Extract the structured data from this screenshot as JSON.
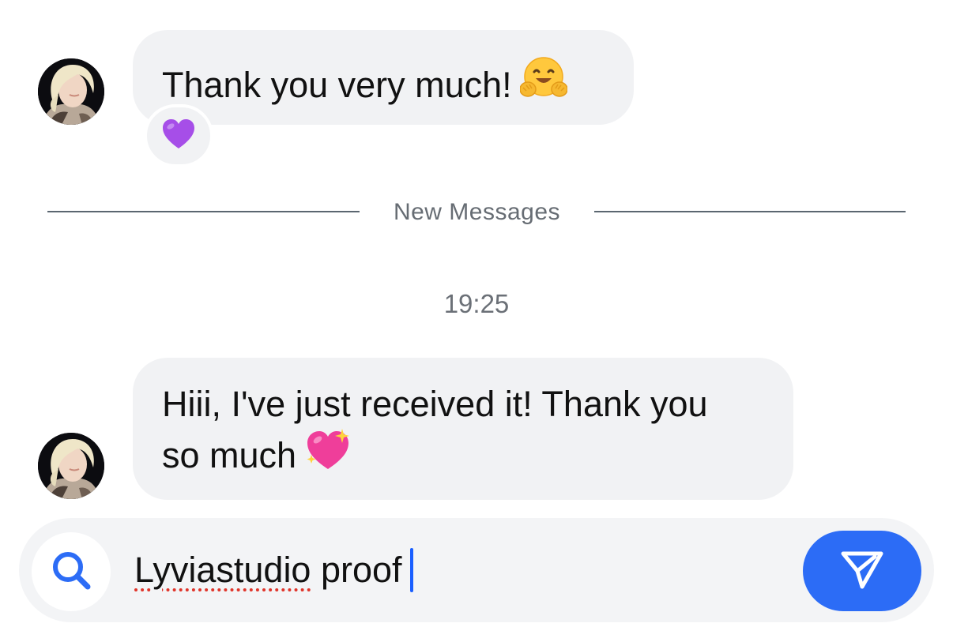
{
  "messages": [
    {
      "text": "Thank you very much!",
      "emoji": "hugging-face-emoji",
      "reaction": "purple-heart-emoji"
    },
    {
      "text_line1": "Hiii, I've just received it! Thank you",
      "text_line2": "so much",
      "emoji": "sparkling-heart-emoji"
    }
  ],
  "divider": {
    "label": "New Messages"
  },
  "timestamp": "19:25",
  "composer": {
    "misspelled_word": "Lyviastudio",
    "rest_text": " proof",
    "search_icon": "search-icon",
    "send_icon": "send-icon"
  },
  "colors": {
    "bubble": "#f1f2f4",
    "accent": "#2c6cf6",
    "divider": "#5b6670",
    "muted_text": "#666c73",
    "spellcheck": "#e0352b"
  }
}
